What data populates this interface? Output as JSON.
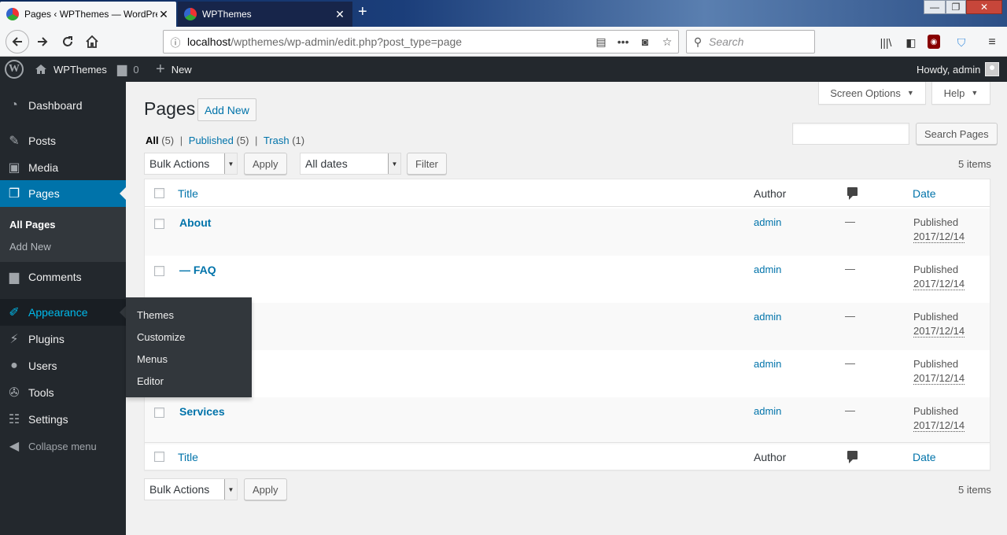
{
  "browser": {
    "tabs": [
      {
        "title": "Pages ‹ WPThemes — WordPre",
        "close": "✕"
      },
      {
        "title": "WPThemes",
        "close": "✕"
      }
    ],
    "new_tab": "+",
    "window_controls": {
      "min": "—",
      "max": "❐",
      "close": "✕"
    },
    "url_host": "localhost",
    "url_path": "/wpthemes/wp-admin/edit.php?post_type=page",
    "search_placeholder": "Search"
  },
  "adminbar": {
    "site_name": "WPThemes",
    "comments_count": "0",
    "new_label": "New",
    "howdy": "Howdy, admin"
  },
  "sidebar": {
    "items": [
      {
        "label": "Dashboard",
        "icon": "dashboard-icon"
      },
      {
        "label": "Posts",
        "icon": "pin-icon"
      },
      {
        "label": "Media",
        "icon": "media-icon"
      },
      {
        "label": "Pages",
        "icon": "pages-icon"
      },
      {
        "label": "Comments",
        "icon": "comment-icon"
      },
      {
        "label": "Appearance",
        "icon": "brush-icon"
      },
      {
        "label": "Plugins",
        "icon": "plug-icon"
      },
      {
        "label": "Users",
        "icon": "user-icon"
      },
      {
        "label": "Tools",
        "icon": "wrench-icon"
      },
      {
        "label": "Settings",
        "icon": "settings-icon"
      },
      {
        "label": "Collapse menu",
        "icon": "collapse-icon"
      }
    ],
    "pages_submenu": [
      "All Pages",
      "Add New"
    ],
    "appearance_flyout": [
      "Themes",
      "Customize",
      "Menus",
      "Editor"
    ]
  },
  "header": {
    "screen_options": "Screen Options",
    "help": "Help",
    "title": "Pages",
    "add_new": "Add New"
  },
  "filters": {
    "all": "All",
    "all_count": "(5)",
    "published": "Published",
    "published_count": "(5)",
    "trash": "Trash",
    "trash_count": "(1)",
    "separator": "|"
  },
  "search_button": "Search Pages",
  "bulk_actions": "Bulk Actions",
  "apply": "Apply",
  "all_dates": "All dates",
  "filter": "Filter",
  "items_count": "5 items",
  "columns": {
    "title": "Title",
    "author": "Author",
    "date": "Date"
  },
  "rows": [
    {
      "title": "About",
      "author": "admin",
      "comments": "—",
      "status": "Published",
      "date": "2017/12/14"
    },
    {
      "title": "— FAQ",
      "author": "admin",
      "comments": "—",
      "status": "Published",
      "date": "2017/12/14"
    },
    {
      "title": "",
      "author": "admin",
      "comments": "—",
      "status": "Published",
      "date": "2017/12/14"
    },
    {
      "title": "",
      "author": "admin",
      "comments": "—",
      "status": "Published",
      "date": "2017/12/14"
    },
    {
      "title": "Services",
      "author": "admin",
      "comments": "—",
      "status": "Published",
      "date": "2017/12/14"
    }
  ],
  "colors": {
    "accent": "#0073aa",
    "sidebar": "#23282d",
    "hover": "#00b9eb"
  }
}
